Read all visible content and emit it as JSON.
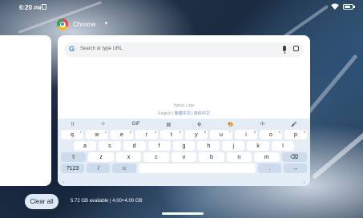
{
  "status_bar": {
    "time": "6:20",
    "ampm": "PM",
    "battery_level": 0.8
  },
  "app": {
    "name": "Chrome",
    "icon": "chrome-icon"
  },
  "browser": {
    "search_placeholder": "Search or type URL",
    "content_logo_alt": "Yahoo Logo",
    "lang_prefix": "English | ",
    "lang_link_1": "繁體中文",
    "lang_sep": " | ",
    "lang_link_2": "简体中文"
  },
  "keyboard": {
    "toolbar": [
      "⠿",
      "☺",
      "GIF",
      "▤",
      "⚙",
      "🎨",
      "‹I›",
      "🎤"
    ],
    "rows": [
      [
        {
          "k": "q",
          "s": "1"
        },
        {
          "k": "w",
          "s": "2"
        },
        {
          "k": "e",
          "s": "3"
        },
        {
          "k": "r",
          "s": "4"
        },
        {
          "k": "t",
          "s": "5"
        },
        {
          "k": "y",
          "s": "6"
        },
        {
          "k": "u",
          "s": "7"
        },
        {
          "k": "i",
          "s": "8"
        },
        {
          "k": "o",
          "s": "9"
        },
        {
          "k": "p",
          "s": "0"
        }
      ],
      [
        {
          "k": "a"
        },
        {
          "k": "s"
        },
        {
          "k": "d"
        },
        {
          "k": "f"
        },
        {
          "k": "g"
        },
        {
          "k": "h"
        },
        {
          "k": "j"
        },
        {
          "k": "k"
        },
        {
          "k": "l"
        }
      ],
      [
        {
          "k": "⇧",
          "special": true
        },
        {
          "k": "z"
        },
        {
          "k": "x"
        },
        {
          "k": "c"
        },
        {
          "k": "v"
        },
        {
          "k": "b"
        },
        {
          "k": "n"
        },
        {
          "k": "m"
        },
        {
          "k": "⌫",
          "special": true
        }
      ],
      [
        {
          "k": "?123",
          "special": true
        },
        {
          "k": "/",
          "special": true
        },
        {
          "k": "☺",
          "special": true
        },
        {
          "k": " ",
          "wide": true
        },
        {
          "k": ".",
          "special": true
        },
        {
          "k": "→",
          "special": true
        }
      ]
    ]
  },
  "recents": {
    "clear_all": "Clear all",
    "storage": "5.72 GB available | 4.00+4.00 GB"
  }
}
